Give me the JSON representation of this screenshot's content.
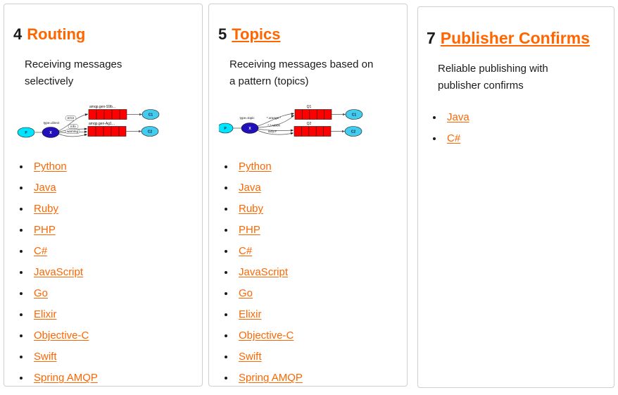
{
  "page": {
    "background_color": "#ffffff",
    "card_border_color": "#cfcfcf",
    "link_color": "#ff6600",
    "text_color": "#1b1b1b"
  },
  "cards": [
    {
      "number": "4",
      "title": "Routing",
      "title_underlined": false,
      "description": "Receiving messages selectively",
      "diagram": {
        "name": "direct-exchange-diagram",
        "producer": "P",
        "exchange": "X",
        "exchange_type_label": "type=direct",
        "binding_keys": [
          "error",
          "info",
          "warning"
        ],
        "queues": [
          "amqp.gen-S9b...",
          "amqp.gen-Ag1..."
        ],
        "consumers": [
          "C1",
          "C2"
        ]
      },
      "links": [
        "Python",
        "Java",
        "Ruby",
        "PHP",
        "C#",
        "JavaScript",
        "Go",
        "Elixir",
        "Objective-C",
        "Swift",
        "Spring AMQP"
      ]
    },
    {
      "number": "5",
      "title": "Topics",
      "title_underlined": true,
      "description": "Receiving messages based on a pattern (topics)",
      "diagram": {
        "name": "topic-exchange-diagram",
        "producer": "P",
        "exchange": "X",
        "exchange_type_label": "type=topic",
        "binding_keys": [
          "*.orange.*",
          "*.*.rabbit",
          "lazy.#"
        ],
        "queues": [
          "Q1",
          "Q2"
        ],
        "consumers": [
          "C1",
          "C2"
        ]
      },
      "links": [
        "Python",
        "Java",
        "Ruby",
        "PHP",
        "C#",
        "JavaScript",
        "Go",
        "Elixir",
        "Objective-C",
        "Swift",
        "Spring AMQP"
      ]
    },
    {
      "number": "7",
      "title": "Publisher Confirms",
      "title_underlined": true,
      "description": "Reliable publishing with publisher confirms",
      "diagram": null,
      "links": [
        "Java",
        "C#"
      ]
    }
  ]
}
